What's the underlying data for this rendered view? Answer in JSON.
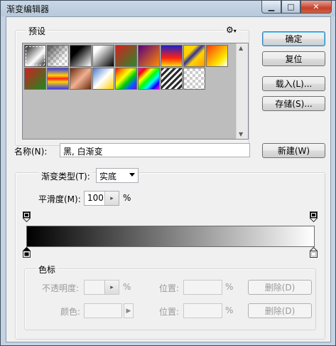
{
  "window": {
    "title": "渐变编辑器"
  },
  "presets": {
    "label": "预设",
    "gear_glyph": "⚙",
    "swatches": [
      {
        "bg": "linear-gradient(135deg,#1a1a1a,#fff 60%,#1a1a1a)"
      },
      {
        "bg": "checker-grey"
      },
      {
        "bg": "linear-gradient(135deg,#000 30%,#fff)"
      },
      {
        "bg": "linear-gradient(135deg,#fff 20%,#000)"
      },
      {
        "bg": "linear-gradient(135deg,#d42020,#2a8a2a)"
      },
      {
        "bg": "linear-gradient(135deg,#5a0080,#ff8a00)"
      },
      {
        "bg": "linear-gradient(180deg,#1e22c8,#ff2010 60%,#ffde00)"
      },
      {
        "bg": "linear-gradient(135deg,#ffd400 30%,#3030a0 45%,#ffd400 60%,#ff9a00)"
      },
      {
        "bg": "linear-gradient(135deg,#ff3a10,#ffe800 70%,#fff)"
      },
      {
        "bg": "linear-gradient(135deg,#d02020,#1a8a20)"
      },
      {
        "bg": "linear-gradient(180deg,#3a3af0,#ffd400 35%,#ff2020 50%,#ffd400 65%,#3a3af0)"
      },
      {
        "bg": "linear-gradient(135deg,#6a2a10,#f0b090 50%,#6a2a10)"
      },
      {
        "bg": "linear-gradient(135deg,#4a7ad0,#fff 50%,#ffd000)"
      },
      {
        "bg": "linear-gradient(135deg,#ff0000,#ff9900,#ffff00,#00d000,#0060ff,#8000ff)"
      },
      {
        "bg": "linear-gradient(135deg,#ff00ff,#ff0000,#ffff00,#00ff00,#00ffff,#0000ff,#ff00ff)"
      },
      {
        "bg": "repeating-linear-gradient(135deg,#2a2a2a 0 3px,#ffffff 3px 6px)"
      },
      {
        "bg": "checker"
      }
    ]
  },
  "buttons": {
    "ok": "确定",
    "reset": "复位",
    "load": "载入(L)...",
    "save": "存储(S)...",
    "new": "新建(W)",
    "delete1": "删除(D)",
    "delete2": "删除(D)"
  },
  "name": {
    "label": "名称(N):",
    "value": "黑, 白渐变"
  },
  "gradient_type": {
    "label": "渐变类型(T):",
    "value": "实底"
  },
  "smoothness": {
    "label": "平滑度(M):",
    "value": "100",
    "unit": "%"
  },
  "stops_group": {
    "title": "色标",
    "opacity_label": "不透明度:",
    "opacity_unit": "%",
    "position_label_1": "位置:",
    "position_unit_1": "%",
    "color_label": "颜色:",
    "position_label_2": "位置:",
    "position_unit_2": "%"
  },
  "colors": {
    "gradient_start": "#000000",
    "gradient_end": "#ffffff",
    "accent": "#3c7fb1"
  }
}
